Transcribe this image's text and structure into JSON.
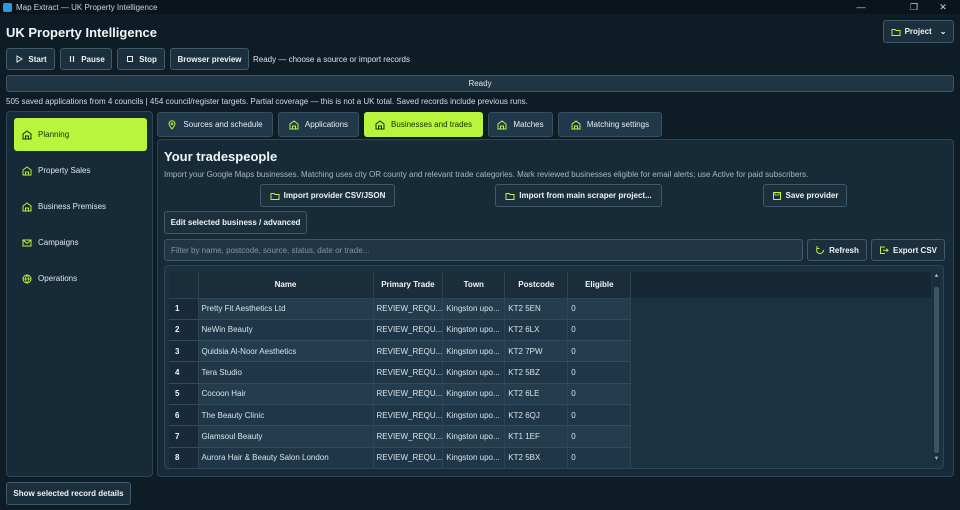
{
  "window": {
    "title": "Map Extract — UK Property Intelligence"
  },
  "app": {
    "title": "UK Property Intelligence",
    "project_label": "Project"
  },
  "toolbar": {
    "start_label": "Start",
    "pause_label": "Pause",
    "stop_label": "Stop",
    "preview_label": "Browser preview",
    "status_text": "Ready — choose a source or import records"
  },
  "progress": {
    "label": "Ready"
  },
  "summary": "505 saved applications from 4 councils | 454 council/register targets. Partial coverage — this is not a UK total. Saved records include previous runs.",
  "sidebar": {
    "items": [
      {
        "label": "Planning",
        "icon": "building-icon",
        "active": true
      },
      {
        "label": "Property Sales",
        "icon": "building-icon"
      },
      {
        "label": "Business Premises",
        "icon": "building-icon"
      },
      {
        "label": "Campaigns",
        "icon": "mail-icon"
      },
      {
        "label": "Operations",
        "icon": "globe-icon"
      }
    ]
  },
  "tabs": [
    {
      "label": "Sources and schedule",
      "icon": "map-pin-icon"
    },
    {
      "label": "Applications",
      "icon": "building-icon"
    },
    {
      "label": "Businesses and trades",
      "icon": "building-icon",
      "active": true
    },
    {
      "label": "Matches",
      "icon": "building-icon"
    },
    {
      "label": "Matching settings",
      "icon": "building-icon"
    }
  ],
  "section": {
    "title": "Your tradespeople",
    "description": "Import your Google Maps businesses. Matching uses city OR county and relevant trade categories. Mark reviewed businesses eligible for email alerts; use Active for paid subscribers."
  },
  "actions": {
    "import_csv": "Import provider CSV/JSON",
    "import_scraper": "Import from main scraper project...",
    "save_provider": "Save provider",
    "edit_selected": "Edit selected business / advanced",
    "refresh": "Refresh",
    "export_csv": "Export CSV"
  },
  "filter": {
    "placeholder": "Filter by name, postcode, source, status, date or trade..."
  },
  "table": {
    "columns": [
      "Name",
      "Primary Trade",
      "Town",
      "Postcode",
      "Eligible"
    ],
    "rows": [
      {
        "num": "1",
        "name": "Pretty Fit Aesthetics Ltd",
        "trade": "REVIEW_REQU...",
        "town": "Kingston upo...",
        "postcode": "KT2 5EN",
        "eligible": "0"
      },
      {
        "num": "2",
        "name": "NeWin Beauty",
        "trade": "REVIEW_REQU...",
        "town": "Kingston upo...",
        "postcode": "KT2 6LX",
        "eligible": "0"
      },
      {
        "num": "3",
        "name": "Quidsia Al-Noor Aesthetics",
        "trade": "REVIEW_REQU...",
        "town": "Kingston upo...",
        "postcode": "KT2 7PW",
        "eligible": "0"
      },
      {
        "num": "4",
        "name": "Tera Studio",
        "trade": "REVIEW_REQU...",
        "town": "Kingston upo...",
        "postcode": "KT2 5BZ",
        "eligible": "0"
      },
      {
        "num": "5",
        "name": "Cocoon Hair",
        "trade": "REVIEW_REQU...",
        "town": "Kingston upo...",
        "postcode": "KT2 6LE",
        "eligible": "0"
      },
      {
        "num": "6",
        "name": "The Beauty Clinic",
        "trade": "REVIEW_REQU...",
        "town": "Kingston upo...",
        "postcode": "KT2 6QJ",
        "eligible": "0"
      },
      {
        "num": "7",
        "name": "Glamsoul Beauty",
        "trade": "REVIEW_REQU...",
        "town": "Kingston upo...",
        "postcode": "KT1 1EF",
        "eligible": "0"
      },
      {
        "num": "8",
        "name": "Aurora Hair & Beauty Salon London",
        "trade": "REVIEW_REQU...",
        "town": "Kingston upo...",
        "postcode": "KT2 5BX",
        "eligible": "0"
      }
    ]
  },
  "footer": {
    "details_label": "Show selected record details"
  },
  "colors": {
    "accent": "#b8f53c",
    "background": "#0e1c26",
    "panel": "#172a37"
  }
}
